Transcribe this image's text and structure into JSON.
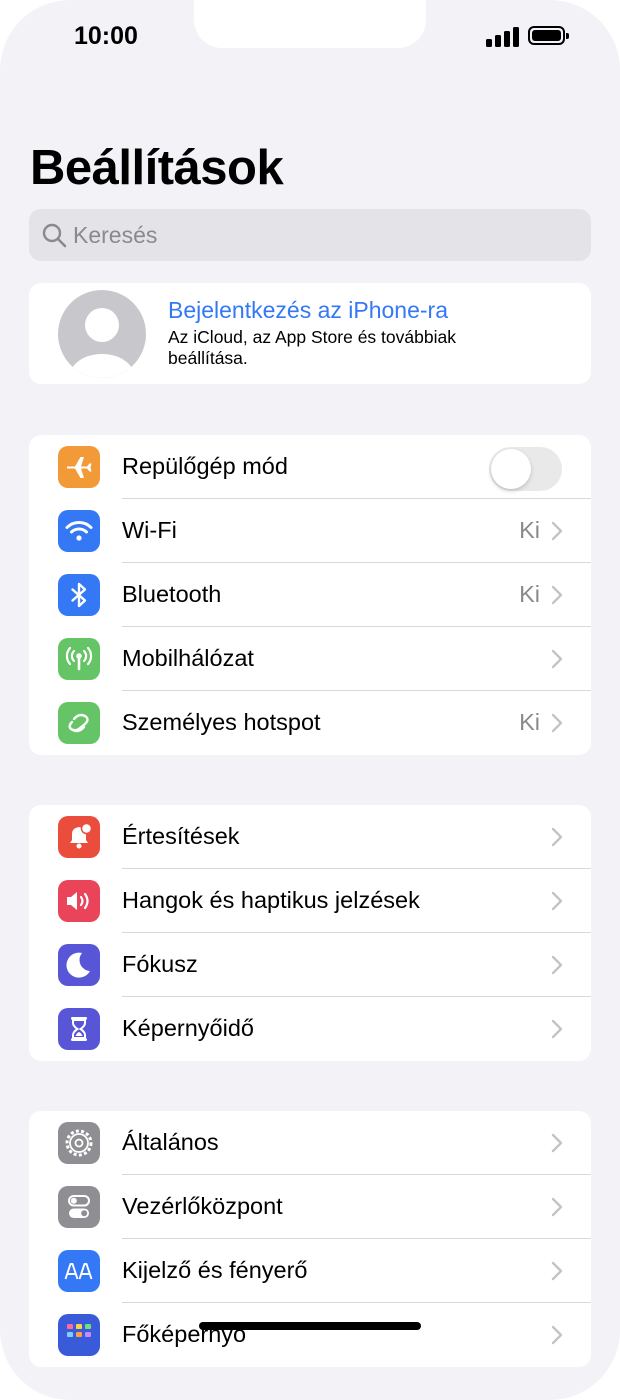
{
  "status_bar": {
    "time": "10:00"
  },
  "page_title": "Beállítások",
  "search": {
    "placeholder": "Keresés"
  },
  "account": {
    "title": "Bejelentkezés az iPhone-ra",
    "subtitle": "Az iCloud, az App Store és továbbiak beállítása."
  },
  "group1": [
    {
      "label": "Repülőgép mód",
      "icon": "airplane-icon",
      "color": "#f19a37",
      "toggle": false
    },
    {
      "label": "Wi-Fi",
      "value": "Ki",
      "icon": "wifi-icon",
      "color": "#3478f6"
    },
    {
      "label": "Bluetooth",
      "value": "Ki",
      "icon": "bluetooth-icon",
      "color": "#3478f6"
    },
    {
      "label": "Mobilhálózat",
      "icon": "cellular-icon",
      "color": "#65c466"
    },
    {
      "label": "Személyes hotspot",
      "value": "Ki",
      "icon": "hotspot-icon",
      "color": "#65c466"
    }
  ],
  "group2": [
    {
      "label": "Értesítések",
      "icon": "notifications-icon",
      "color": "#eb4d3d"
    },
    {
      "label": "Hangok és haptikus jelzések",
      "icon": "sounds-icon",
      "color": "#ea445a"
    },
    {
      "label": "Fókusz",
      "icon": "moon-icon",
      "color": "#5856d6"
    },
    {
      "label": "Képernyőidő",
      "icon": "hourglass-icon",
      "color": "#5856d6"
    }
  ],
  "group3": [
    {
      "label": "Általános",
      "icon": "gear-icon",
      "color": "#8e8e93"
    },
    {
      "label": "Vezérlőközpont",
      "icon": "control-center-icon",
      "color": "#8e8e93"
    },
    {
      "label": "Kijelző és fényerő",
      "icon": "display-icon",
      "color": "#3478f6"
    },
    {
      "label": "Főképernyő",
      "icon": "home-screen-icon",
      "color": "#3a5bd9"
    }
  ]
}
